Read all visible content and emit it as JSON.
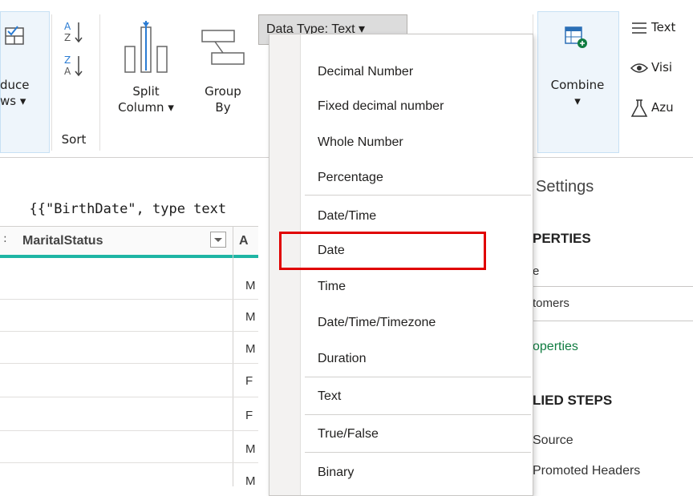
{
  "ribbon": {
    "reduce_rows": {
      "line1": "duce",
      "line2": "ws ▾"
    },
    "sort_label": "Sort",
    "sort_asc_glyph": "A↓Z",
    "sort_desc_glyph": "Z↓A",
    "split_column": {
      "line1": "Split",
      "line2": "Column ▾"
    },
    "group_by": {
      "line1": "Group",
      "line2": "By"
    },
    "data_type_button": "Data Type: Text ▾",
    "combine": {
      "line1": "Combine",
      "line2": "▾"
    },
    "text_analytics": "Text",
    "vision": "Visi",
    "azure_ml": "Azu"
  },
  "formula_bar": {
    "text": "{{\"BirthDate\", type text"
  },
  "grid": {
    "column_header": "MaritalStatus",
    "next_col_type": "A",
    "rows": [
      "M",
      "M",
      "M",
      "F",
      "F",
      "M",
      "M"
    ]
  },
  "query_settings": {
    "title": "Settings",
    "properties_heading": "PERTIES",
    "name_label": "e",
    "name_value": "tomers",
    "all_properties_link": "operties",
    "applied_steps_heading": "LIED STEPS",
    "steps": [
      "Source",
      "Promoted Headers"
    ]
  },
  "data_type_menu": {
    "items": [
      "Decimal Number",
      "Fixed decimal number",
      "Whole Number",
      "Percentage",
      "Date/Time",
      "Date",
      "Time",
      "Date/Time/Timezone",
      "Duration",
      "Text",
      "True/False",
      "Binary"
    ],
    "highlighted": "Date"
  },
  "colors": {
    "highlight_box": "#e00000",
    "grid_accent": "#1fb5a4",
    "link": "#107c41"
  }
}
